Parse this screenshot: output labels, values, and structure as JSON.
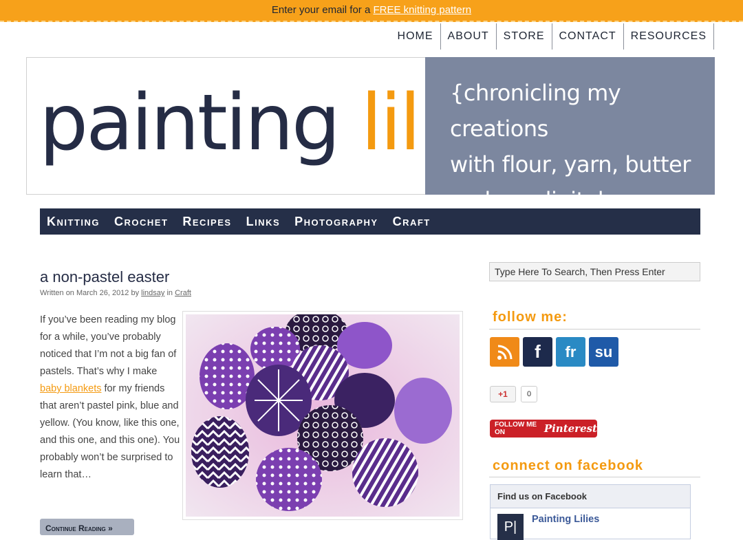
{
  "banner": {
    "prefix": "Enter your email for a",
    "link": "FREE knitting pattern"
  },
  "top_nav": [
    "HOME",
    "ABOUT",
    "STORE",
    "CONTACT",
    "RESOURCES"
  ],
  "header": {
    "logo_word1": "painting",
    "logo_word2": "lilies",
    "tagline_lines": [
      "{chronicling my creations",
      "with flour, yarn, butter",
      "and my digital camera}"
    ]
  },
  "main_nav": [
    "Knitting",
    "Crochet",
    "Recipes",
    "Links",
    "Photography",
    "Craft"
  ],
  "post": {
    "title": "a non-pastel easter",
    "meta_prefix": "Written on March 26, 2012 by",
    "author": "lindsay",
    "meta_in": "in",
    "category": "Craft",
    "excerpt_before": "If you’ve been reading my blog for a while, you’ve probably noticed that I’m not a big fan of pastels. That’s why I make",
    "excerpt_link": "baby blankets",
    "excerpt_after": "for my friends that aren’t pastel pink, blue and yellow. (You know, like this one, and this one, and this one). You probably won’t be surprised to learn that…",
    "continue_label": "Continue Reading »"
  },
  "sidebar": {
    "search_placeholder": "Type Here To Search, Then Press Enter",
    "follow_title": "follow me:",
    "social_icons": [
      {
        "name": "rss-icon",
        "glyph": "◣",
        "color": "#f08a18"
      },
      {
        "name": "facebook-icon",
        "glyph": "f",
        "color": "#1d2a4c"
      },
      {
        "name": "friendfeed-icon",
        "glyph": "fr",
        "color": "#2a8ac4"
      },
      {
        "name": "stumbleupon-icon",
        "glyph": "su",
        "color": "#1f5aa8"
      }
    ],
    "gplus_label": "+1",
    "gplus_count": "0",
    "pinterest_prefix": "FOLLOW ME ON",
    "pinterest_brand": "Pinterest",
    "facebook_title": "connect on facebook",
    "fb_box_header": "Find us on Facebook",
    "fb_page_name": "Painting Lilies"
  },
  "colors": {
    "accent": "#f49a10",
    "navy": "#252f48",
    "tagline_bg": "#7c879f"
  }
}
